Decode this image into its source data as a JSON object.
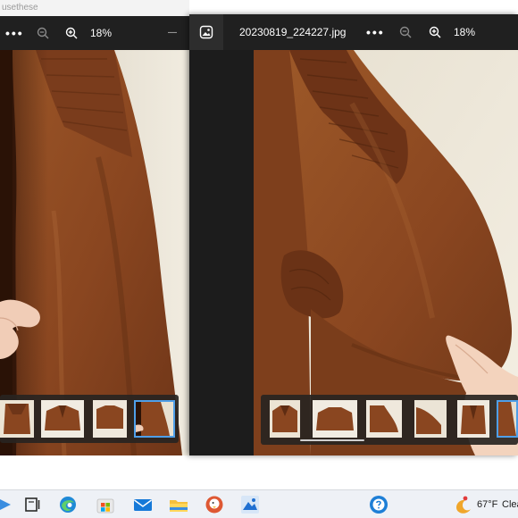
{
  "left_window": {
    "title_fragment": "usethese",
    "more_label": "•••",
    "zoom_level": "18%",
    "minimize_label": "—",
    "icons": [
      "more-icon",
      "zoom-out-icon",
      "zoom-in-icon",
      "minimize-icon"
    ]
  },
  "right_window": {
    "filename": "20230819_224227.jpg",
    "more_label": "•••",
    "zoom_level": "18%",
    "icons": [
      "photos-app-icon",
      "more-icon",
      "zoom-out-icon",
      "zoom-in-icon"
    ]
  },
  "taskbar": {
    "icons": [
      "widgets-icon",
      "task-view-icon",
      "edge-icon",
      "store-icon",
      "mail-icon",
      "file-explorer-icon",
      "duckduckgo-icon",
      "photos-icon",
      "help-icon",
      "weather-icon"
    ],
    "temperature": "67°F",
    "weather_condition": "Clea"
  },
  "colors": {
    "viewer_background": "#202020",
    "filmstrip_background": "#282421",
    "selected_thumb_border": "#4f9fe8",
    "taskbar_background": "#eef1f6",
    "leather_brown": "#8a4a24",
    "wall": "#ece6d8"
  }
}
